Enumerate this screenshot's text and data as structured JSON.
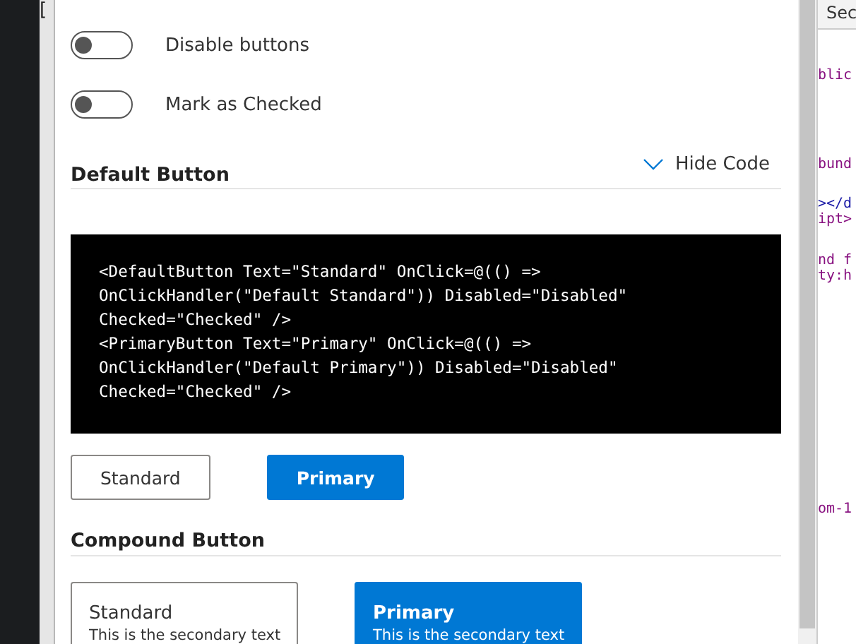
{
  "left_strip": {
    "text": "["
  },
  "toggles": [
    {
      "label": "Disable buttons",
      "on": false
    },
    {
      "label": "Mark as Checked",
      "on": false
    }
  ],
  "default_section": {
    "title": "Default Button",
    "code_toggle": {
      "label": "Hide Code",
      "expanded": true
    },
    "code_lines": [
      "<DefaultButton Text=\"Standard\" OnClick=@(() =>",
      "OnClickHandler(\"Default Standard\")) Disabled=\"Disabled\"",
      "Checked=\"Checked\" />",
      "<PrimaryButton Text=\"Primary\" OnClick=@(() =>",
      "OnClickHandler(\"Default Primary\")) Disabled=\"Disabled\"",
      "Checked=\"Checked\" />"
    ],
    "buttons": [
      {
        "label": "Standard",
        "kind": "standard"
      },
      {
        "label": "Primary",
        "kind": "primary"
      }
    ]
  },
  "compound_section": {
    "title": "Compound Button",
    "buttons": [
      {
        "label": "Standard",
        "secondary": "This is the secondary text",
        "kind": "standard"
      },
      {
        "label": "Primary",
        "secondary": "This is the secondary text",
        "kind": "primary"
      }
    ]
  },
  "devtools": {
    "tab": "Sec",
    "lines": [
      {
        "text": "blic",
        "kind": "tag"
      },
      {
        "text": "bund",
        "kind": "tag"
      },
      {
        "text": "></d",
        "kind": "punct"
      },
      {
        "text": "ipt>",
        "kind": "tag"
      },
      {
        "text": "nd f",
        "kind": "tag"
      },
      {
        "text": "ty:h",
        "kind": "tag"
      },
      {
        "text": "om-1",
        "kind": "tag"
      }
    ]
  }
}
